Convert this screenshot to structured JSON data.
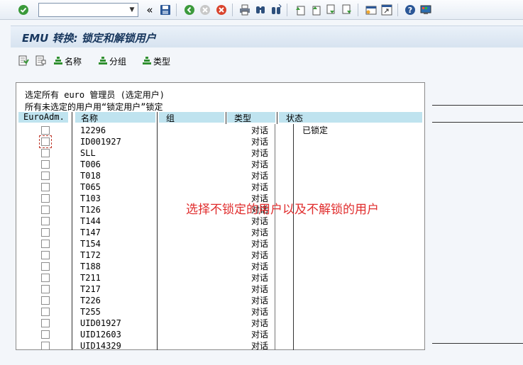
{
  "toolbar": {
    "command_field_value": "",
    "icons": [
      "confirm-icon",
      "back-icon",
      "save-icon",
      "back-nav-icon",
      "exit-icon",
      "cancel-icon",
      "print-icon",
      "find-icon",
      "find-next-icon",
      "first-page-icon",
      "prev-page-icon",
      "next-page-icon",
      "last-page-icon",
      "new-session-icon",
      "shortcut-icon",
      "help-icon",
      "layout-icon"
    ]
  },
  "title": "EMU 转换: 锁定和解锁用户",
  "app_toolbar": {
    "name_label": "名称",
    "group_label": "分组",
    "type_label": "类型"
  },
  "list": {
    "intro_line1": "选定所有 euro 管理员 (选定用户)",
    "intro_line2": "所有未选定的用户用“锁定用户”锁定",
    "headers": {
      "euro_adm": "EuroAdm.",
      "name": "名称",
      "group": "组",
      "type": "类型",
      "status": "状态"
    },
    "rows": [
      {
        "name": "12296",
        "type": "对话",
        "status": "已锁定"
      },
      {
        "name": "ID001927",
        "type": "对话",
        "status": ""
      },
      {
        "name": "SLL",
        "type": "对话",
        "status": ""
      },
      {
        "name": "T006",
        "type": "对话",
        "status": ""
      },
      {
        "name": "T018",
        "type": "对话",
        "status": ""
      },
      {
        "name": "T065",
        "type": "对话",
        "status": ""
      },
      {
        "name": "T103",
        "type": "对话",
        "status": ""
      },
      {
        "name": "T126",
        "type": "对话",
        "status": ""
      },
      {
        "name": "T144",
        "type": "对话",
        "status": ""
      },
      {
        "name": "T147",
        "type": "对话",
        "status": ""
      },
      {
        "name": "T154",
        "type": "对话",
        "status": ""
      },
      {
        "name": "T172",
        "type": "对话",
        "status": ""
      },
      {
        "name": "T188",
        "type": "对话",
        "status": ""
      },
      {
        "name": "T211",
        "type": "对话",
        "status": ""
      },
      {
        "name": "T217",
        "type": "对话",
        "status": ""
      },
      {
        "name": "T226",
        "type": "对话",
        "status": ""
      },
      {
        "name": "T255",
        "type": "对话",
        "status": ""
      },
      {
        "name": "UID01927",
        "type": "对话",
        "status": ""
      },
      {
        "name": "UID12603",
        "type": "对话",
        "status": ""
      },
      {
        "name": "UID14329",
        "type": "对话",
        "status": ""
      }
    ]
  },
  "annotation": "选择不锁定的用户以及不解锁的用户"
}
